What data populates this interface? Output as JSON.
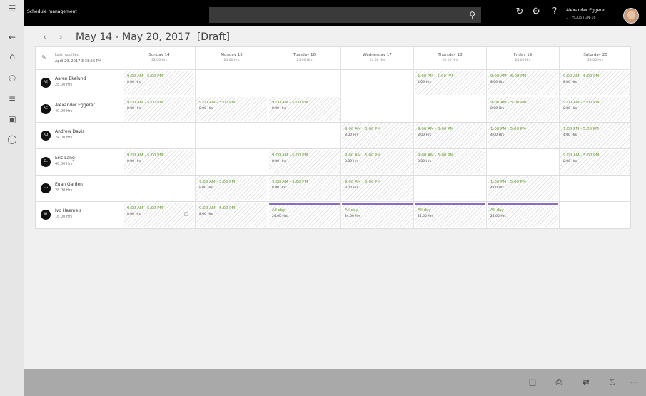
{
  "app": {
    "title": "Schedule management"
  },
  "user": {
    "name": "Alexander Eggerer",
    "sub": "1 - HOUSTON-16"
  },
  "header": {
    "range": "May 14 - May 20, 2017",
    "status": "[Draft]"
  },
  "last_modified": {
    "label": "Last modified",
    "value": "April 20, 2017 3:33:56 PM"
  },
  "days": [
    {
      "name": "Sunday 14",
      "hours": "32.00 Hrs"
    },
    {
      "name": "Monday 15",
      "hours": "24.00 Hrs"
    },
    {
      "name": "Tuesday 16",
      "hours": "24.00 Hrs"
    },
    {
      "name": "Wednesday 17",
      "hours": "24.00 Hrs"
    },
    {
      "name": "Thursday 18",
      "hours": "20.00 Hrs"
    },
    {
      "name": "Friday 19",
      "hours": "24.00 Hrs"
    },
    {
      "name": "Saturday 20",
      "hours": "28.00 Hrs"
    }
  ],
  "employees": [
    {
      "initials": "AE",
      "name": "Aaren Ekelund",
      "hours": "28.00 Hrs",
      "shifts": [
        {
          "time": "9:00 AM - 5:00 PM",
          "hours": "8.00 Hrs"
        },
        null,
        null,
        null,
        {
          "time": "1:00 PM - 5:00 PM",
          "hours": "4.00 Hrs"
        },
        {
          "time": "9:00 AM - 5:00 PM",
          "hours": "8.00 Hrs"
        },
        {
          "time": "9:00 AM - 5:00 PM",
          "hours": "8.00 Hrs"
        }
      ]
    },
    {
      "initials": "AE",
      "name": "Alexander Eggerer",
      "hours": "40.00 Hrs",
      "shifts": [
        {
          "time": "9:00 AM - 5:00 PM",
          "hours": "8.00 Hrs"
        },
        {
          "time": "9:00 AM - 5:00 PM",
          "hours": "8.00 Hrs"
        },
        {
          "time": "9:00 AM - 5:00 PM",
          "hours": "8.00 Hrs"
        },
        null,
        null,
        {
          "time": "9:00 AM - 5:00 PM",
          "hours": "8.00 Hrs"
        },
        {
          "time": "9:00 AM - 5:00 PM",
          "hours": "8.00 Hrs"
        }
      ]
    },
    {
      "initials": "AD",
      "name": "Andrew Davis",
      "hours": "24.00 Hrs",
      "shifts": [
        null,
        null,
        null,
        {
          "time": "9:00 AM - 5:00 PM",
          "hours": "8.00 Hrs"
        },
        {
          "time": "9:00 AM - 5:00 PM",
          "hours": "8.00 Hrs"
        },
        {
          "time": "1:00 PM - 5:00 PM",
          "hours": "4.00 Hrs"
        },
        {
          "time": "1:00 PM - 5:00 PM",
          "hours": "4.00 Hrs"
        }
      ]
    },
    {
      "initials": "EL",
      "name": "Eric Lang",
      "hours": "40.00 Hrs",
      "shifts": [
        {
          "time": "9:00 AM - 5:00 PM",
          "hours": "8.00 Hrs"
        },
        null,
        {
          "time": "9:00 AM - 5:00 PM",
          "hours": "8.00 Hrs"
        },
        {
          "time": "9:00 AM - 5:00 PM",
          "hours": "8.00 Hrs"
        },
        {
          "time": "9:00 AM - 5:00 PM",
          "hours": "8.00 Hrs"
        },
        null,
        {
          "time": "9:00 AM - 5:00 PM",
          "hours": "8.00 Hrs"
        }
      ]
    },
    {
      "initials": "EG",
      "name": "Euan Garden",
      "hours": "28.00 Hrs",
      "shifts": [
        null,
        {
          "time": "9:00 AM - 5:00 PM",
          "hours": "8.00 Hrs"
        },
        {
          "time": "9:00 AM - 5:00 PM",
          "hours": "8.00 Hrs"
        },
        {
          "time": "9:00 AM - 5:00 PM",
          "hours": "8.00 Hrs"
        },
        null,
        {
          "time": "1:00 PM - 5:00 PM",
          "hours": "4.00 Hrs"
        },
        null
      ]
    },
    {
      "initials": "IH",
      "name": "Ivo Haemels",
      "hours": "16.00 Hrs",
      "shifts": [
        {
          "time": "9:00 AM - 5:00 PM",
          "hours": "8.00 Hrs",
          "note": true
        },
        {
          "time": "9:00 AM - 5:00 PM",
          "hours": "8.00 Hrs"
        },
        {
          "time": "All day",
          "hours": "24.00 Hrs",
          "allday": true
        },
        {
          "time": "All day",
          "hours": "24.00 Hrs",
          "allday": true
        },
        {
          "time": "All day",
          "hours": "24.00 Hrs",
          "allday": true
        },
        {
          "time": "All day",
          "hours": "24.00 Hrs",
          "allday": true
        },
        null
      ]
    }
  ],
  "colors": {
    "shift_time": "#6b9a3a",
    "allday_bar": "#8a6cc2",
    "topbar": "#000000",
    "bottombar": "#a9a9a9"
  },
  "icons": {
    "rail": [
      "hamburger-icon",
      "back-arrow-icon",
      "home-icon",
      "people-icon",
      "list-icon",
      "clipboard-icon",
      "circle-icon"
    ],
    "topbar": [
      "search-icon",
      "refresh-icon",
      "settings-icon",
      "help-icon"
    ],
    "bottombar": [
      "publish-icon",
      "print-icon",
      "swap-icon",
      "share-icon",
      "more-icon"
    ]
  }
}
